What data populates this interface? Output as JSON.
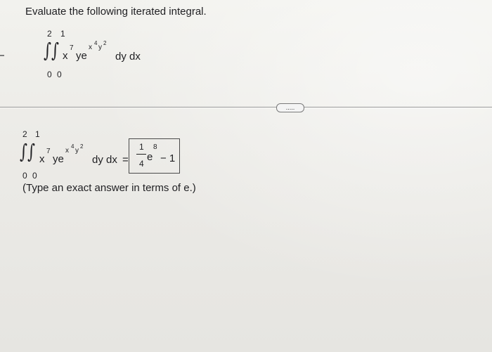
{
  "question": {
    "title": "Evaluate the following iterated integral.",
    "outer_upper": "2",
    "inner_upper": "1",
    "outer_lower": "0",
    "inner_lower": "0",
    "integrand_base": "x",
    "integrand_x_power": "7",
    "integrand_y": "ye",
    "exp_base": "x",
    "exp_x_power": "4",
    "exp_y": "y",
    "exp_y_power": "2",
    "differentials": "dy dx"
  },
  "more_button": {
    "label": "....."
  },
  "answer": {
    "differentials": "dy dx",
    "equals": "=",
    "fraction_numerator": "1",
    "fraction_denominator": "4",
    "e_base": "e",
    "e_power": "8",
    "minus_one": "− 1",
    "hint": "(Type an exact answer in terms of e.)"
  }
}
